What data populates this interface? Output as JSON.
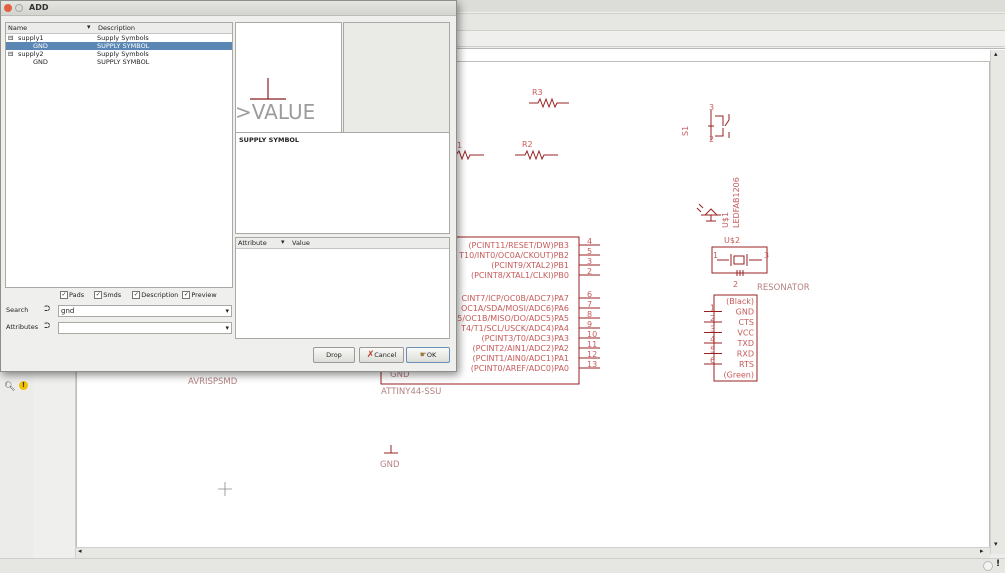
{
  "dialog": {
    "title": "ADD",
    "tree_headers": {
      "name": "Name",
      "description": "Description"
    },
    "tree_rows": [
      {
        "name": "supply1",
        "desc": "Supply Symbols",
        "expander": "⊟",
        "indent": 0,
        "selected": false
      },
      {
        "name": "GND",
        "desc": "SUPPLY SYMBOL",
        "expander": "",
        "indent": 1,
        "selected": true
      },
      {
        "name": "supply2",
        "desc": "Supply Symbols",
        "expander": "⊟",
        "indent": 0,
        "selected": false
      },
      {
        "name": "GND",
        "desc": "SUPPLY SYMBOL",
        "expander": "",
        "indent": 1,
        "selected": false
      }
    ],
    "preview_value": ">VALUE",
    "description_text": "SUPPLY SYMBOL",
    "attr_headers": {
      "attribute": "Attribute",
      "value": "Value"
    },
    "checkboxes": {
      "pads": "Pads",
      "smds": "Smds",
      "description": "Description",
      "preview": "Preview"
    },
    "search_label": "Search",
    "search_value": "gnd",
    "attributes_label": "Attributes",
    "attributes_value": "",
    "buttons": {
      "drop": "Drop",
      "cancel": "Cancel",
      "ok": "OK"
    }
  },
  "schematic": {
    "r3": "R3",
    "r2": "R2",
    "r1_partial": "1",
    "s1": "S1",
    "led": "LEDFAB1206",
    "u1": "U$1",
    "u2": "U$2",
    "resonator": "RESONATOR",
    "avrisp": "AVRISPSMD",
    "attiny": "ATTINY44-SSU",
    "gnd_symbol": "GND",
    "gnd_partial": "GND",
    "attiny_pins": [
      {
        "label": "(PCINT11/RESET/DW)PB3",
        "num": "4"
      },
      {
        "label": "T10/INT0/OC0A/CKOUT)PB2",
        "num": "5"
      },
      {
        "label": "(PCINT9/XTAL2)PB1",
        "num": "3"
      },
      {
        "label": "(PCINT8/XTAL1/CLKI)PB0",
        "num": "2"
      },
      {
        "label": "CINT7/ICP/OC0B/ADC7)PA7",
        "num": "6"
      },
      {
        "label": "OC1A/SDA/MOSI/ADC6)PA6",
        "num": "7"
      },
      {
        "label": "5/OC1B/MISO/DO/ADC5)PA5",
        "num": "8"
      },
      {
        "label": "T4/T1/SCL/USCK/ADC4)PA4",
        "num": "9"
      },
      {
        "label": "(PCINT3/T0/ADC3)PA3",
        "num": "10"
      },
      {
        "label": "(PCINT2/AIN1/ADC2)PA2",
        "num": "11"
      },
      {
        "label": "(PCINT1/AIN0/ADC1)PA1",
        "num": "12"
      },
      {
        "label": "(PCINT0/AREF/ADC0)PA0",
        "num": "13"
      }
    ],
    "ftdi_pins": [
      {
        "label": "(Black)",
        "num": ""
      },
      {
        "label": "GND",
        "num": "1"
      },
      {
        "label": "CTS",
        "num": "2"
      },
      {
        "label": "VCC",
        "num": "3"
      },
      {
        "label": "TXD",
        "num": "4"
      },
      {
        "label": "RXD",
        "num": "5"
      },
      {
        "label": "RTS",
        "num": "6"
      },
      {
        "label": "(Green)",
        "num": ""
      }
    ],
    "resonator_pins": {
      "left": "1",
      "right": "3",
      "bottom": "2"
    }
  }
}
